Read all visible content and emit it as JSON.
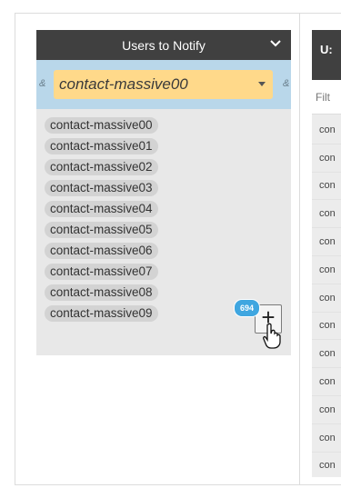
{
  "left_panel": {
    "title": "Users to Notify",
    "select": {
      "value": "contact-massive00"
    },
    "amp_left": "&",
    "amp_right": "&",
    "items": [
      "contact-massive00",
      "contact-massive01",
      "contact-massive02",
      "contact-massive03",
      "contact-massive04",
      "contact-massive05",
      "contact-massive06",
      "contact-massive07",
      "contact-massive08",
      "contact-massive09"
    ],
    "add_count": "694",
    "add_label": "+"
  },
  "right_panel": {
    "title": "U:",
    "filter_placeholder": "Filt",
    "items": [
      "con",
      "con",
      "con",
      "con",
      "con",
      "con",
      "con",
      "con",
      "con",
      "con",
      "con",
      "con",
      "con"
    ]
  },
  "colors": {
    "header_bg": "#404040",
    "filter_bg": "#b9d7ea",
    "select_bg": "#ffd98a",
    "badge_bg": "#3fa6e0"
  }
}
